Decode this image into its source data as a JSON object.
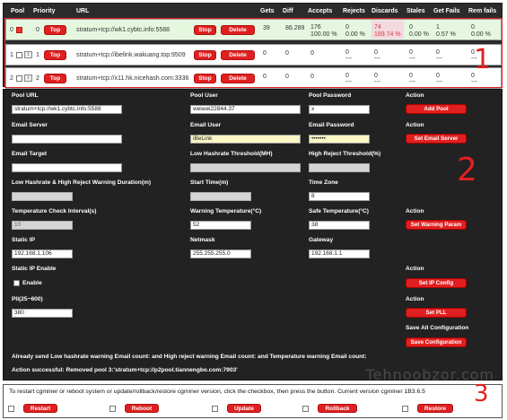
{
  "pool_table": {
    "headers": {
      "pool": "Pool",
      "priority": "Priority",
      "url": "URL",
      "gets": "Gets",
      "diff": "Diff",
      "accepts": "Accepts",
      "rejects": "Rejects",
      "discards": "Discards",
      "stales": "Stales",
      "get_fails": "Get Fails",
      "rem_fails": "Rem fails"
    },
    "rows": [
      {
        "pool": "0",
        "priority": "0",
        "top_label": "Top",
        "url": "stratum+tcp://wk1.cybtc.info:5588",
        "stop_label": "Stop",
        "delete_label": "Delete",
        "gets": "39",
        "diff": "86.289",
        "accepts": "176",
        "accepts_pct": "100.00 %",
        "rejects": "0",
        "rejects_pct": "0.00 %",
        "discards": "74",
        "discards_pct": "189.74 %",
        "stales": "0",
        "stales_pct": "0.00 %",
        "get_fails": "1",
        "get_fails_pct": "0.57 %",
        "rem_fails": "0",
        "rem_fails_pct": "0.00 %"
      },
      {
        "pool": "1",
        "priority": "1",
        "top_label": "Top",
        "url": "stratum+tcp://ibelink.wakuang.top:9509",
        "stop_label": "Stop",
        "delete_label": "Delete",
        "gets": "0",
        "diff": "0",
        "accepts": "0",
        "accepts_pct": "",
        "rejects": "0",
        "rejects_pct": "---",
        "discards": "0",
        "discards_pct": "---",
        "stales": "0",
        "stales_pct": "---",
        "get_fails": "0",
        "get_fails_pct": "---",
        "rem_fails": "0",
        "rem_fails_pct": "---"
      },
      {
        "pool": "2",
        "priority": "2",
        "top_label": "Top",
        "url": "stratum+tcp://x11.hk.nicehash.com:3336",
        "stop_label": "Stop",
        "delete_label": "Delete",
        "gets": "0",
        "diff": "0",
        "accepts": "0",
        "accepts_pct": "",
        "rejects": "0",
        "rejects_pct": "---",
        "discards": "0",
        "discards_pct": "---",
        "stales": "0",
        "stales_pct": "---",
        "get_fails": "0",
        "get_fails_pct": "---",
        "rem_fails": "0",
        "rem_fails_pct": "---"
      }
    ]
  },
  "settings": {
    "pool_url_label": "Pool URL",
    "pool_url_value": "stratum+tcp://wk1.cybtc.info:5588",
    "pool_user_label": "Pool User",
    "pool_user_value": "weiwei22844.37",
    "pool_password_label": "Pool Password",
    "pool_password_value": "x",
    "action_label": "Action",
    "add_pool_label": "Add Pool",
    "email_server_label": "Email Server",
    "email_server_value": "",
    "email_user_label": "Email User",
    "email_user_value": "iBeLink",
    "email_password_label": "Email Password",
    "email_password_value": "•••••••",
    "set_email_server_label": "Set Email Server",
    "email_target_label": "Email Target",
    "email_target_value": "",
    "low_hashrate_threshold_label": "Low Hashrate Threshold(MH)",
    "low_hashrate_threshold_value": "",
    "high_reject_threshold_label": "High Reject Threshold(%)",
    "high_reject_threshold_value": "",
    "warning_duration_label": "Low Hashrate & High Reject Warning Duration(m)",
    "warning_duration_value": "",
    "start_time_label": "Start Time(m)",
    "start_time_value": "",
    "time_zone_label": "Time Zone",
    "time_zone_value": "8",
    "temp_check_interval_label": "Temperature Check Interval(s)",
    "temp_check_interval_value": "10",
    "warning_temp_label": "Warning Temperature(°C)",
    "warning_temp_value": "52",
    "safe_temp_label": "Safe Temperature(°C)",
    "safe_temp_value": "38",
    "set_warning_param_label": "Set Warning Param",
    "static_ip_label": "Static IP",
    "static_ip_value": "192.168.1.106",
    "netmask_label": "Netmask",
    "netmask_value": "255.255.255.0",
    "gateway_label": "Gateway",
    "gateway_value": "192.168.1.1",
    "static_ip_enable_label": "Static IP Enable",
    "enable_label": "Enable",
    "set_ip_config_label": "Set IP Config",
    "pll_label": "Pll(25~600)",
    "pll_value": "380",
    "set_pll_label": "Set PLL",
    "save_all_label": "Save All Configuration",
    "save_config_label": "Save Configuration",
    "email_count_text": "Already send Low hashrate warning Email count:    and High reject warning Email count:    and Temperature warning Email count:",
    "action_status_text": "Action successful: Removed pool 3:'stratum+tcp://p2pool.tiannengbo.com:7903'",
    "watermark": "Tehnoobzor.com"
  },
  "bottom": {
    "message": "To restart cgminer or reboot system or update/rollback/restore cgminer version, click the checkbox, then press the button. Current version cgminer 1B3.6.5",
    "restart_label": "Restart",
    "reboot_label": "Reboot",
    "update_label": "Update",
    "rollback_label": "Rollback",
    "restore_label": "Restore"
  },
  "annotations": {
    "one": "1",
    "two": "2",
    "three": "3"
  },
  "colors": {
    "accent_red": "#e02020",
    "panel_dark": "#222222",
    "row_green": "#e6f7e0"
  }
}
